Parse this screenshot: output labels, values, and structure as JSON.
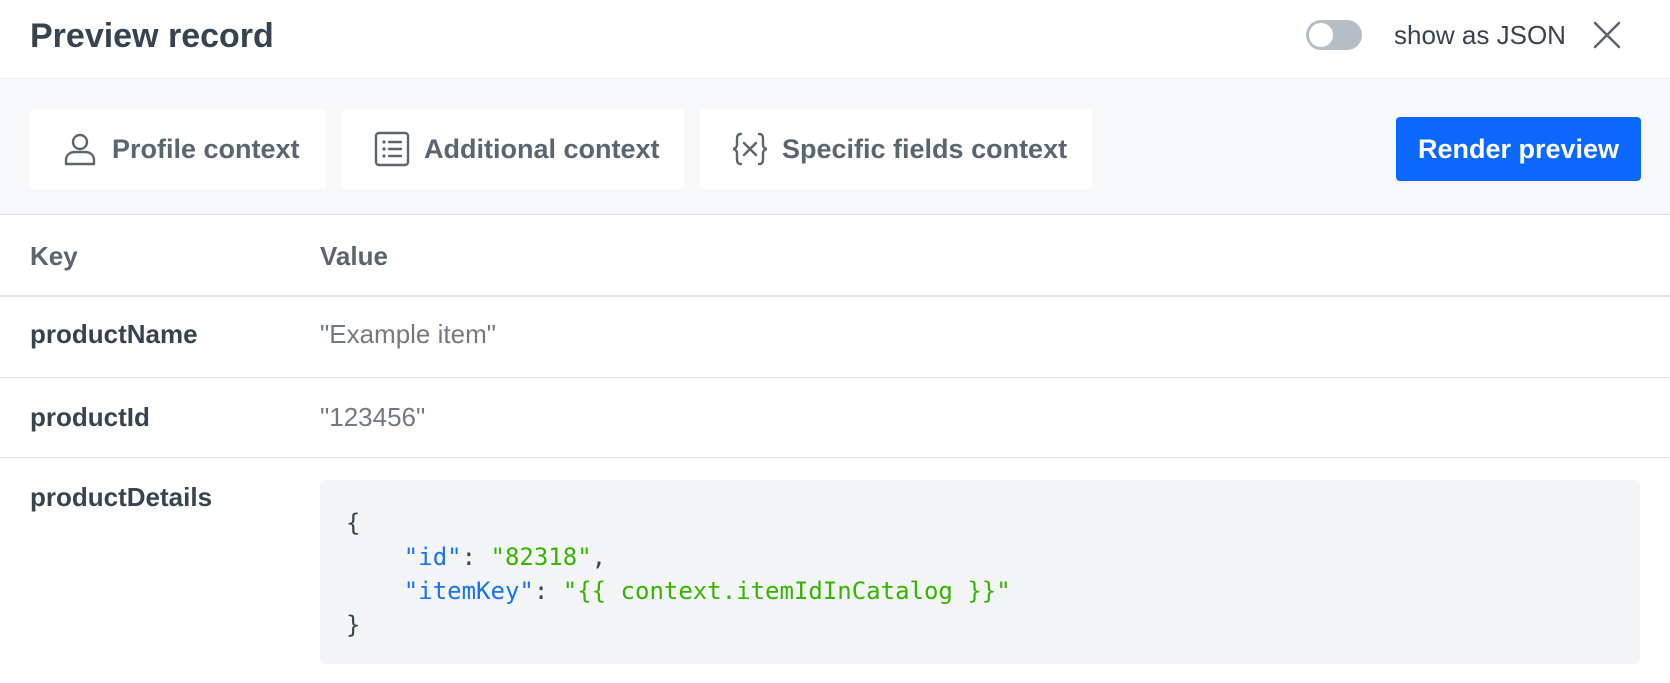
{
  "header": {
    "title": "Preview record",
    "toggle_label": "show as JSON",
    "toggle_on": false
  },
  "toolbar": {
    "buttons": [
      {
        "label": "Profile context",
        "icon": "user-icon"
      },
      {
        "label": "Additional context",
        "icon": "list-icon"
      },
      {
        "label": "Specific fields context",
        "icon": "variable-icon"
      }
    ],
    "render_label": "Render preview"
  },
  "colors": {
    "accent": "#0b68ff",
    "json_key": "#1a73e8",
    "json_string": "#37b400"
  },
  "table": {
    "headers": {
      "key": "Key",
      "value": "Value"
    },
    "rows": [
      {
        "key": "productName",
        "value": "\"Example item\""
      },
      {
        "key": "productId",
        "value": "\"123456\""
      },
      {
        "key": "productDetails"
      }
    ],
    "json_block": {
      "open": "{",
      "close": "}",
      "entries": [
        {
          "key": "\"id\"",
          "colon": ": ",
          "value": "\"82318\"",
          "trail": ","
        },
        {
          "key": "\"itemKey\"",
          "colon": ": ",
          "value": "\"{{ context.itemIdInCatalog }}\"",
          "trail": ""
        }
      ]
    }
  }
}
